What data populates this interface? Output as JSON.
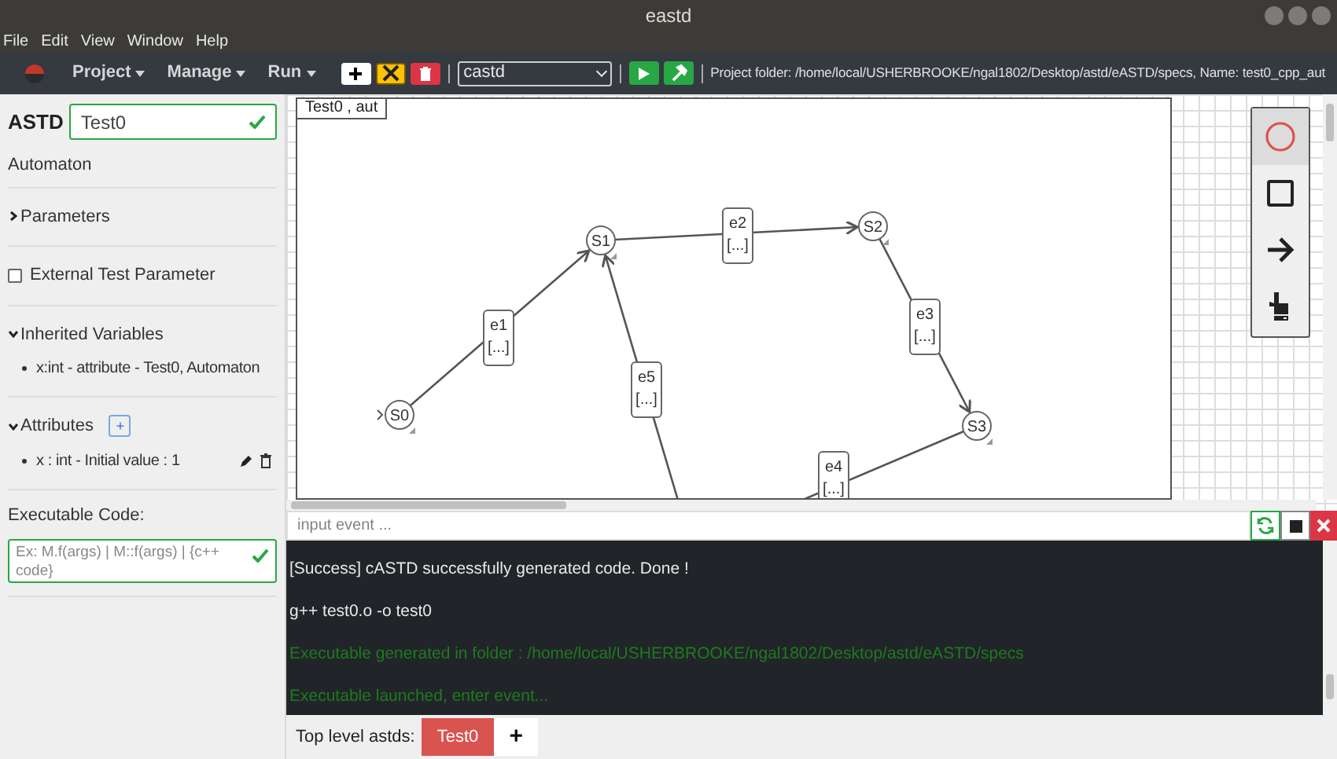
{
  "window": {
    "title": "eastd"
  },
  "menu_bar": [
    "File",
    "Edit",
    "View",
    "Window",
    "Help"
  ],
  "toolbar": {
    "menus": [
      "Project",
      "Manage",
      "Run"
    ],
    "astd_select": "castd",
    "project_info": "Project folder: /home/local/USHERBROOKE/ngal1802/Desktop/astd/eASTD/specs, Name: test0_cpp_aut"
  },
  "sidebar": {
    "astd_label": "ASTD",
    "name_value": "Test0",
    "type": "Automaton",
    "sections": [
      {
        "kind": "collapsible",
        "title": "Parameters",
        "expanded": false
      },
      {
        "kind": "checkbox",
        "title": "External Test Parameter",
        "checked": false
      },
      {
        "kind": "collapsible",
        "title": "Inherited Variables",
        "expanded": true,
        "items": [
          {
            "text": "x:int - attribute - Test0, Automaton"
          }
        ]
      },
      {
        "kind": "collapsible",
        "title": "Attributes",
        "expanded": true,
        "add_button": "+",
        "items": [
          {
            "text": "x : int - Initial value : 1",
            "editable": true
          }
        ]
      }
    ],
    "code_label": "Executable Code:",
    "code_placeholder": "Ex: M.f(args) | M::f(args) | {c++ code}"
  },
  "canvas": {
    "tab_label": "Test0 , aut",
    "states": [
      {
        "label": "S0",
        "initial": true
      },
      {
        "label": "S1",
        "initial": false
      },
      {
        "label": "S2",
        "initial": false
      },
      {
        "label": "S3",
        "initial": false
      }
    ],
    "transitions": [
      {
        "event": "e1",
        "action": "[...]"
      },
      {
        "event": "e2",
        "action": "[...]"
      },
      {
        "event": "e3",
        "action": "[...]"
      },
      {
        "event": "e5",
        "action": "[...]"
      },
      {
        "event": "e4",
        "action": "[...]"
      }
    ],
    "tools": [
      {
        "selected": true
      },
      {
        "selected": false
      },
      {
        "selected": false
      },
      {
        "selected": false
      }
    ]
  },
  "console": {
    "input_placeholder": "input event ...",
    "lines": [
      {
        "kind": "plain",
        "text": "[Success] cASTD successfully generated code. Done !"
      },
      {
        "kind": "plain",
        "text": "g++ test0.o -o test0"
      },
      {
        "kind": "info",
        "text": "Executable generated in folder : /home/local/USHERBROOKE/ngal1802/Desktop/astd/eASTD/specs"
      },
      {
        "kind": "info",
        "text": "Executable launched, enter event..."
      }
    ]
  },
  "bottom_bar": {
    "label": "Top level astds:",
    "tabs": [
      {
        "label": "Test0",
        "selected": true
      }
    ],
    "add_button": "+"
  }
}
